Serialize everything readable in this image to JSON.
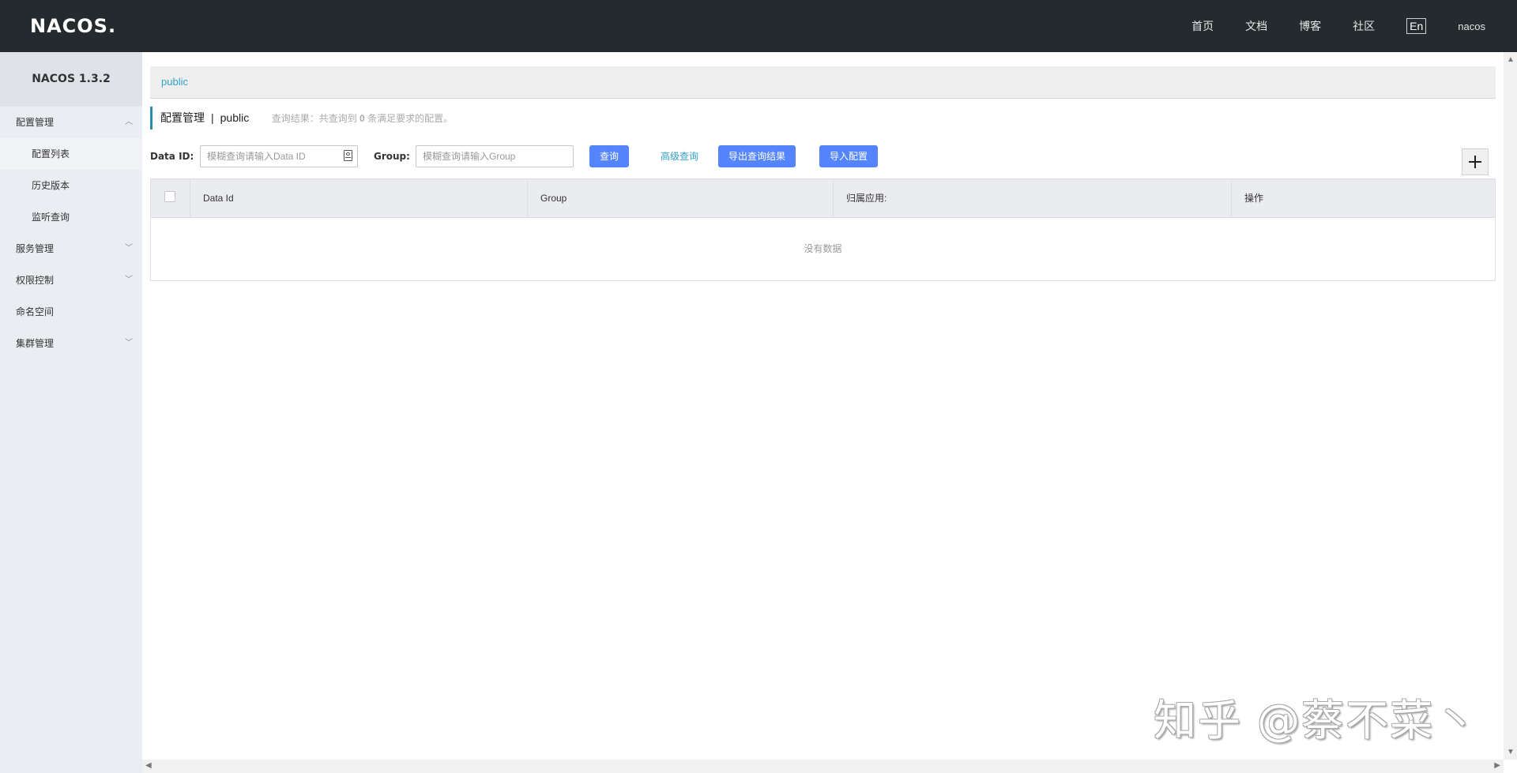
{
  "header": {
    "logo_text": "NACOS.",
    "nav": [
      "首页",
      "文档",
      "博客",
      "社区"
    ],
    "lang_switch": "En",
    "user": "nacos"
  },
  "sidebar": {
    "version": "NACOS 1.3.2",
    "groups": [
      {
        "label": "配置管理",
        "expanded": true,
        "items": [
          {
            "label": "配置列表",
            "active": true
          },
          {
            "label": "历史版本",
            "active": false
          },
          {
            "label": "监听查询",
            "active": false
          }
        ]
      },
      {
        "label": "服务管理",
        "expanded": false
      },
      {
        "label": "权限控制",
        "expanded": false
      },
      {
        "label": "命名空间"
      },
      {
        "label": "集群管理",
        "expanded": false
      }
    ]
  },
  "namespace_bar": {
    "current": "public"
  },
  "page_title": {
    "section": "配置管理",
    "separator": "|",
    "namespace": "public",
    "result_prefix": "查询结果：共查询到",
    "result_count": "0",
    "result_suffix": "条满足要求的配置。"
  },
  "filters": {
    "data_id_label": "Data ID:",
    "data_id_placeholder": "模糊查询请输入Data ID",
    "data_id_value": "",
    "group_label": "Group:",
    "group_placeholder": "模糊查询请输入Group",
    "group_value": "",
    "query_button": "查询",
    "advanced_query": "高级查询",
    "export_button": "导出查询结果",
    "import_button": "导入配置"
  },
  "table": {
    "columns": [
      "Data Id",
      "Group",
      "归属应用:",
      "操作"
    ],
    "rows": [],
    "empty_text": "没有数据"
  },
  "watermark": "知乎 @蔡不菜丶",
  "colors": {
    "header_bg": "#252a2f",
    "sidebar_bg": "#eaedf1",
    "primary_button": "#5584ff",
    "link": "#33a0c7",
    "title_accent": "#2d8cab"
  }
}
